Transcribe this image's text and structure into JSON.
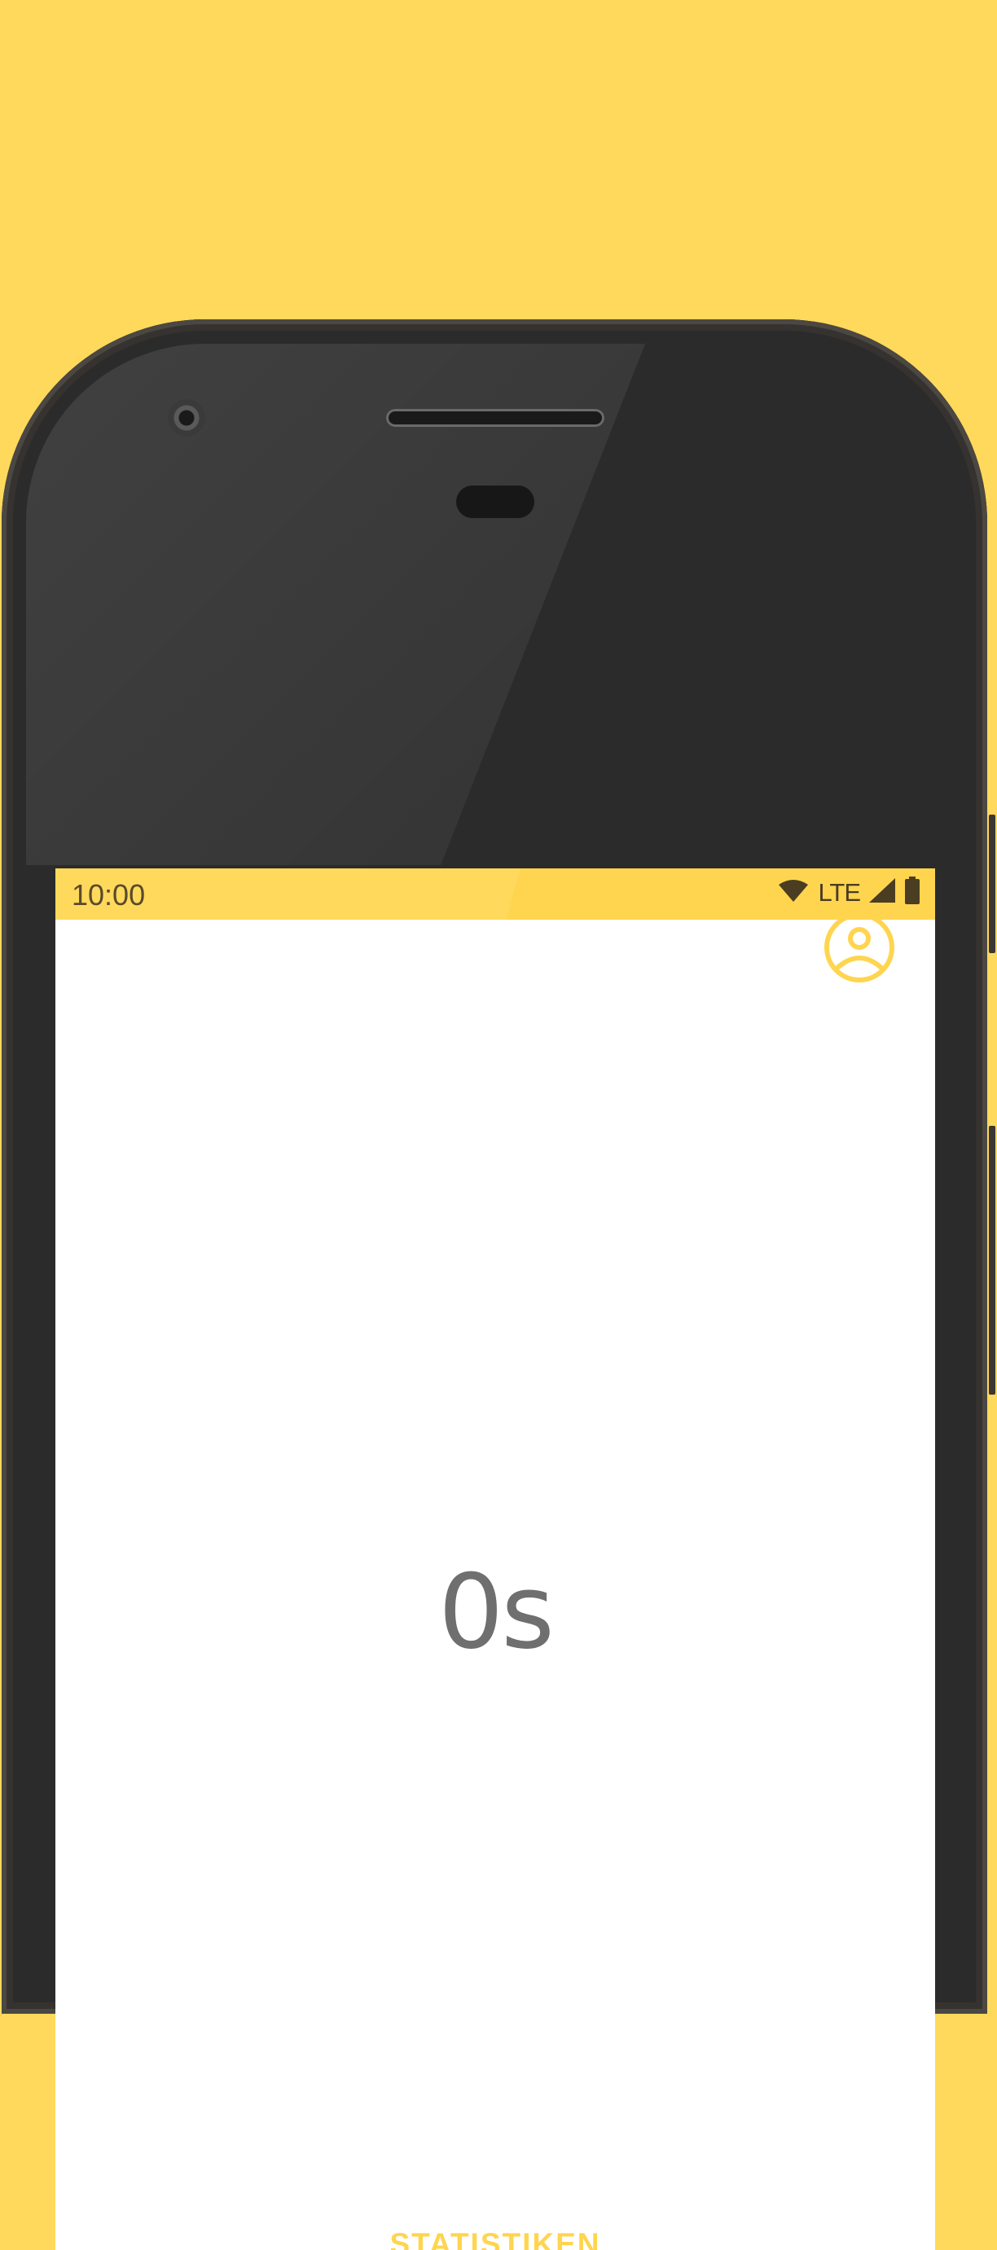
{
  "status_bar": {
    "time": "10:00",
    "network_label": "LTE",
    "icons": [
      "wifi-icon",
      "signal-icon",
      "battery-icon"
    ]
  },
  "main": {
    "profile_icon": "account-icon",
    "timer_value": "0s",
    "stats_button_label": "STATISTIKEN"
  },
  "colors": {
    "accent": "#FFD54F",
    "background": "#FFD95C",
    "timer_text": "#6F6F6F"
  }
}
